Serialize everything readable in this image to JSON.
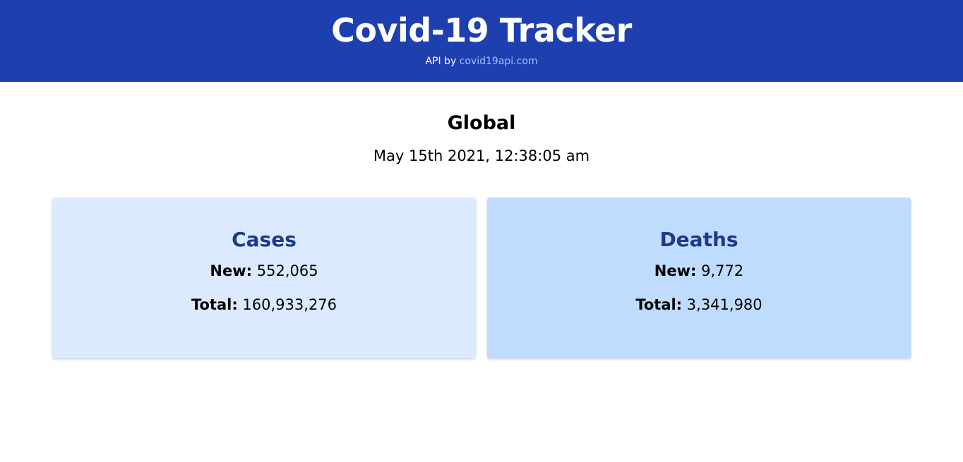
{
  "header": {
    "title": "Covid-19 Tracker",
    "credit_prefix": "API by",
    "credit_link": "covid19api.com"
  },
  "main": {
    "region": "Global",
    "timestamp": "May 15th 2021, 12:38:05 am"
  },
  "cards": [
    {
      "title": "Cases",
      "new_label": "New:",
      "new_value": "552,065",
      "total_label": "Total:",
      "total_value": "160,933,276"
    },
    {
      "title": "Deaths",
      "new_label": "New:",
      "new_value": "9,772",
      "total_label": "Total:",
      "total_value": "3,341,980"
    }
  ],
  "colors": {
    "header_bg": "#1e40af",
    "link": "#93c5fd",
    "cases_card_bg": "#dbeafe",
    "deaths_card_bg": "#bfdbfe",
    "card_title": "#1e3a8a"
  }
}
